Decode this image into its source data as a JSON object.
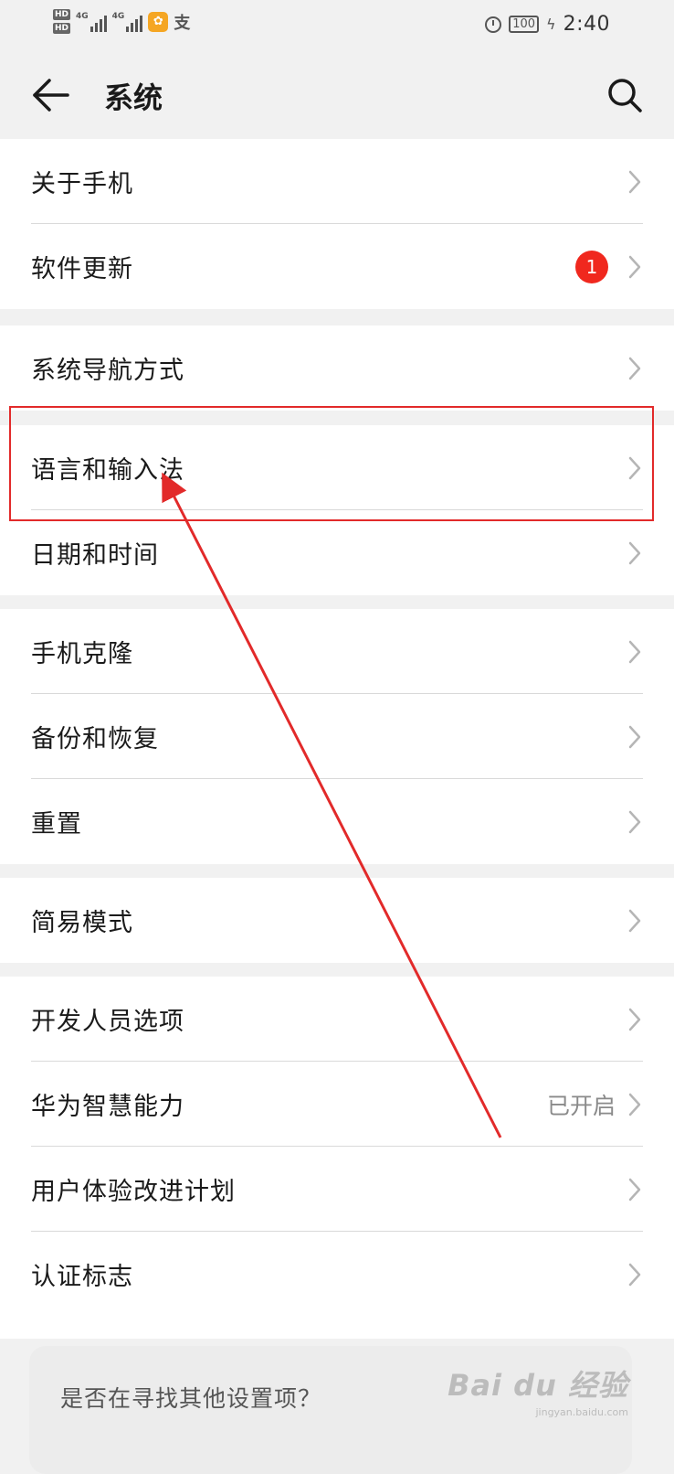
{
  "status_bar": {
    "sim1": "HD",
    "sim2": "HD",
    "net1": "4G",
    "net2": "4G",
    "uc_app_icon": "uc-browser-icon",
    "alipay_icon": "支",
    "battery": "100",
    "time": "2:40"
  },
  "header": {
    "title": "系统"
  },
  "groups": [
    {
      "items": [
        {
          "label": "关于手机"
        },
        {
          "label": "软件更新",
          "badge": "1"
        }
      ]
    },
    {
      "items": [
        {
          "label": "系统导航方式"
        },
        {
          "label": "语言和输入法"
        },
        {
          "label": "日期和时间"
        }
      ]
    },
    {
      "items": [
        {
          "label": "手机克隆"
        },
        {
          "label": "备份和恢复"
        },
        {
          "label": "重置"
        }
      ]
    },
    {
      "items": [
        {
          "label": "简易模式"
        }
      ]
    },
    {
      "items": [
        {
          "label": "开发人员选项"
        },
        {
          "label": "华为智慧能力",
          "value": "已开启"
        },
        {
          "label": "用户体验改进计划"
        },
        {
          "label": "认证标志"
        }
      ]
    }
  ],
  "more_settings": {
    "text": "是否在寻找其他设置项？"
  },
  "watermark": {
    "main": "Bai du 经验",
    "sub": "jingyan.baidu.com"
  },
  "colors": {
    "annotation_red": "#e22a2a",
    "badge_red": "#f0281e"
  }
}
